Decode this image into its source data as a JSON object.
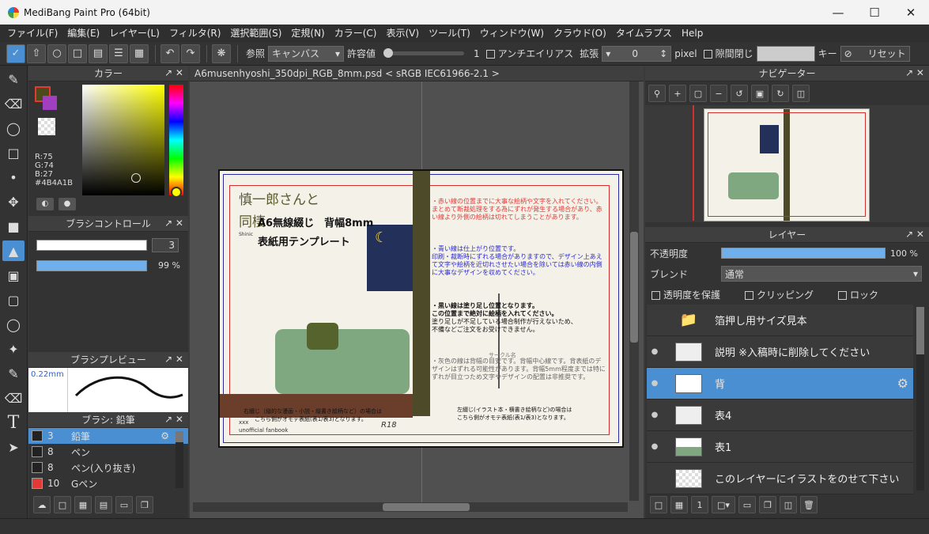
{
  "app": {
    "title": "MediBang Paint Pro (64bit)"
  },
  "menu": [
    "ファイル(F)",
    "編集(E)",
    "レイヤー(L)",
    "フィルタ(R)",
    "選択範囲(S)",
    "定規(N)",
    "カラー(C)",
    "表示(V)",
    "ツール(T)",
    "ウィンドウ(W)",
    "クラウド(O)",
    "タイムラプス",
    "Help"
  ],
  "toolbar": {
    "ref_label": "参照",
    "ref_value": "キャンバス",
    "tolerance_label": "許容値",
    "tolerance_value": "1",
    "antialias_label": "アンチエイリアス",
    "expand_label": "拡張",
    "expand_value": "0",
    "unit": "pixel",
    "gap_label": "隙間閉じ",
    "key_label": "キー",
    "reset_label": "リセット"
  },
  "color_panel": {
    "title": "カラー",
    "r": "R:75",
    "g": "G:74",
    "b": "B:27",
    "hex": "#4B4A1B",
    "primary": "#4B4A1B",
    "secondary": "#a040c0"
  },
  "brush_control": {
    "title": "ブラシコントロール",
    "size": "3",
    "opacity": "99 %"
  },
  "brush_preview": {
    "title": "ブラシプレビュー",
    "size": "0.22mm"
  },
  "brush_list": {
    "title": "ブラシ: 鉛筆",
    "items": [
      {
        "size": "3",
        "name": "鉛筆",
        "color": "#222222"
      },
      {
        "size": "8",
        "name": "ペン",
        "color": "#222222"
      },
      {
        "size": "8",
        "name": "ペン(入り抜き)",
        "color": "#222222"
      },
      {
        "size": "10",
        "name": "Gペン",
        "color": "#e53935"
      }
    ]
  },
  "canvas": {
    "tab": "A6musenhyoshi_350dpi_RGB_8mm.psd < sRGB IEC61966-2.1 >",
    "title1": "慎一郎さんと",
    "title2": "同棲",
    "heading1": "A6無線綴じ　背幅8mm",
    "heading2": "表紙用テンプレート",
    "note_red": "・赤い線の位置までに大事な絵柄や文字を入れてください。まとめて断裁処理をする為にずれが発生する場合があり、赤い線より外側の絵柄は切れてしまうことがあります。",
    "note_blue1": "・青い線は仕上がり位置です。",
    "note_blue2": "印刷・裁断時にずれる場合がありますので、デザイン上あえて文字や絵柄を近切れさせたい場合を除いては赤い線の内側に大事なデザインを収めてください。",
    "note_black1": "・黒い線は塗り足し位置となります。",
    "note_black2": "この位置まで絶対に絵柄を入れてください。",
    "note_black3": "塗り足しが不足している場合制作が行えないため、",
    "note_black4": "不備などご注文をお受けできません。",
    "note_gray": "・灰色の線は背幅の目安です。背幅中心線です。背表紙のデザインはずれる可能性があります。背幅5mm程度までは特にずれが目立つため文字やデザインの配置は非推奨です。",
    "circle": "サークル名",
    "footer_left1": "右綴じ（縦的な漫画・小説・縦書き絵柄など）の場合は",
    "footer_left2": "こちら側がオモテ表紙(表1/表3)となります。",
    "footer_right1": "左綴じ(イラスト本・横書き絵柄など)の場合は",
    "footer_right2": "こちら側がオモテ表紙(表1/表3)となります。",
    "r18": "R18",
    "author": "xxx",
    "fanbook": "unofficial fanbook",
    "small": "Shinic"
  },
  "navigator": {
    "title": "ナビゲーター"
  },
  "layers": {
    "title": "レイヤー",
    "opacity_label": "不透明度",
    "opacity_value": "100 %",
    "blend_label": "ブレンド",
    "blend_value": "通常",
    "protect_label": "透明度を保護",
    "clip_label": "クリッピング",
    "lock_label": "ロック",
    "items": [
      {
        "name": "箔押し用サイズ見本"
      },
      {
        "name": "説明 ※入稿時に削除してください"
      },
      {
        "name": "背"
      },
      {
        "name": "表4"
      },
      {
        "name": "表1"
      },
      {
        "name": "このレイヤーにイラストをのせて下さい"
      }
    ]
  }
}
